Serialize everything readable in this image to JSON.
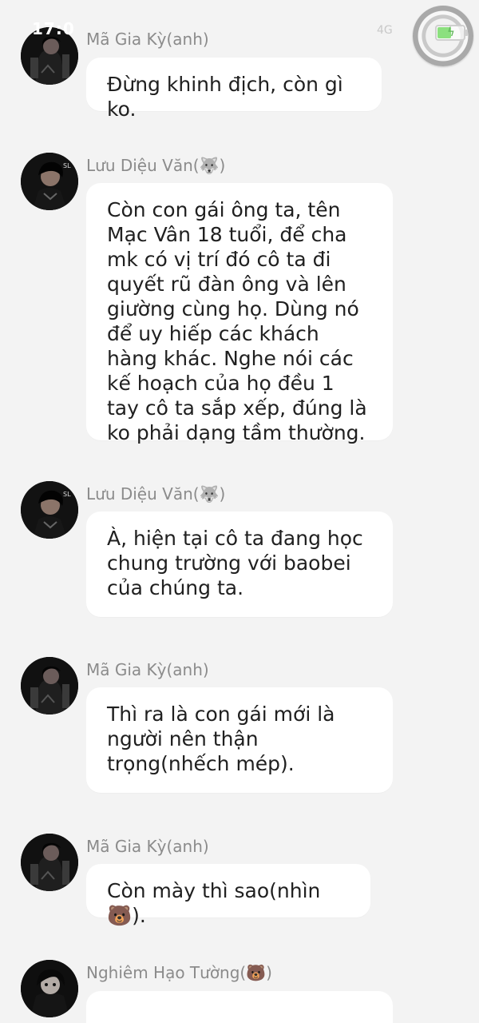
{
  "status_bar": {
    "time": "17:0",
    "network": "4G"
  },
  "messages": [
    {
      "sender": "Mã Gia Kỳ(anh)",
      "text": "Đừng khinh địch, còn gì ko.",
      "avatar": "profile-avatar-1"
    },
    {
      "sender": "Lưu Diệu Văn(🐺)",
      "text": "Còn con gái ông ta, tên Mạc Vân 18 tuổi, để cha mk có vị trí đó cô ta đi quyết rũ đàn ông và lên giường cùng họ. Dùng nó để uy hiếp các khách hàng khác. Nghe nói các kế hoạch của họ đều 1 tay cô ta sắp xếp, đúng là ko phải dạng tầm thường.",
      "avatar": "profile-avatar-2"
    },
    {
      "sender": "Lưu Diệu Văn(🐺)",
      "text": "À, hiện tại cô ta đang học chung trường với baobei của chúng ta.",
      "avatar": "profile-avatar-2"
    },
    {
      "sender": "Mã Gia Kỳ(anh)",
      "text": "Thì ra là con gái mới là người nên thận trọng(nhếch mép).",
      "avatar": "profile-avatar-1"
    },
    {
      "sender": "Mã Gia Kỳ(anh)",
      "text": "Còn mày thì sao(nhìn 🐻).",
      "avatar": "profile-avatar-1"
    },
    {
      "sender": "Nghiêm Hạo Tường(🐻)",
      "text": "",
      "avatar": "profile-avatar-3"
    }
  ],
  "colors": {
    "background": "#f3f3f3",
    "bubble": "#ffffff",
    "name_text": "#8b8b8b",
    "message_text": "#202020"
  }
}
